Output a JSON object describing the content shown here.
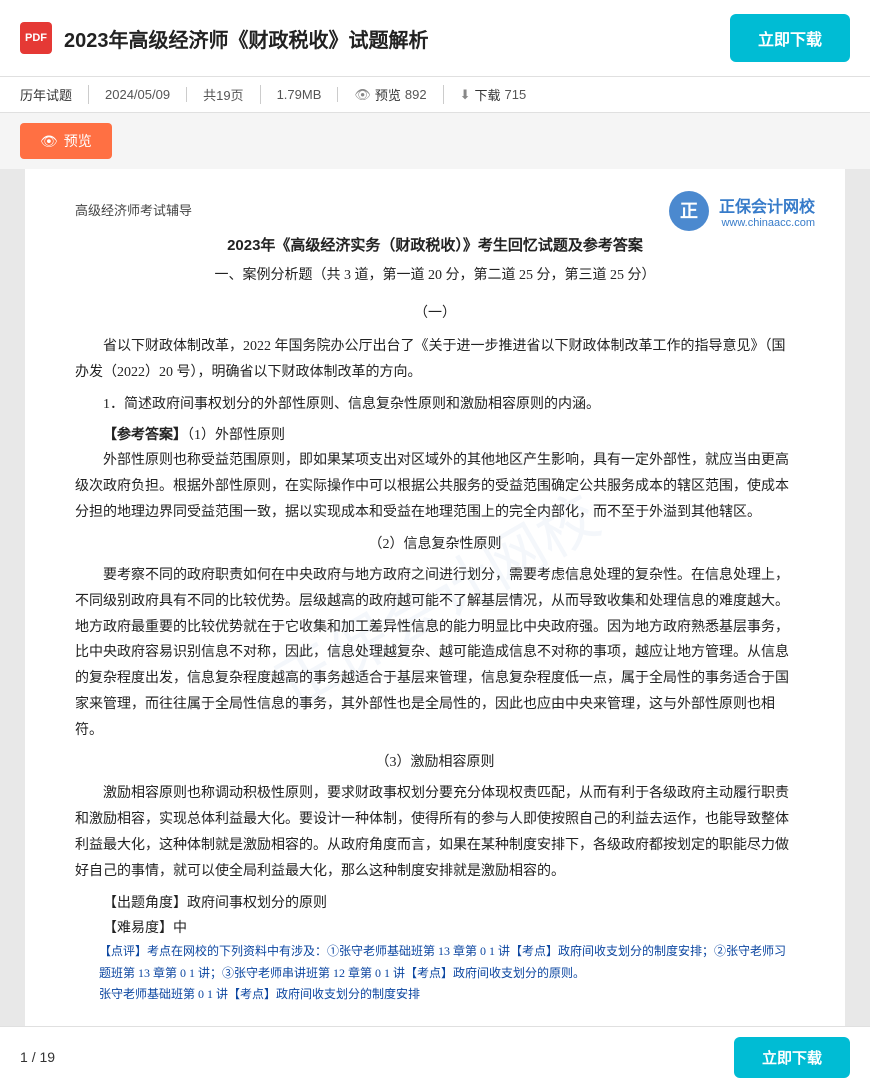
{
  "header": {
    "pdf_label": "PDF",
    "title": "2023年高级经济师《财政税收》试题解析",
    "download_btn": "立即下载"
  },
  "meta": {
    "category": "历年试题",
    "date": "2024/05/09",
    "pages_label": "共19页",
    "size": "1.79MB",
    "preview_label": "预览",
    "preview_count": "892",
    "download_label": "下载",
    "download_count": "715"
  },
  "preview_btn": "预览",
  "doc": {
    "subtitle": "高级经济师考试辅导",
    "main_title": "2023年《高级经济实务（财政税收）》考生回忆试题及参考答案",
    "sub_title": "一、案例分析题（共 3 道，第一道 20 分，第二道 25 分，第三道 25 分）",
    "section1": "（一）",
    "para1": "省以下财政体制改革，2022 年国务院办公厅出台了《关于进一步推进省以下财政体制改革工作的指导意见》（国办发（2022）20 号），明确省以下财政体制改革的方向。",
    "question1": "1．简述政府间事权划分的外部性原则、信息复杂性原则和激励相容原则的内涵。",
    "answer_tag": "【参考答案】",
    "ans1_sub": "（1）外部性原则",
    "ans1_para": "外部性原则也称受益范围原则，即如果某项支出对区域外的其他地区产生影响，具有一定外部性，就应当由更高级次政府负担。根据外部性原则，在实际操作中可以根据公共服务的受益范围确定公共服务成本的辖区范围，使成本分担的地理边界同受益范围一致，据以实现成本和受益在地理范围上的完全内部化，而不至于外溢到其他辖区。",
    "ans2_sub": "（2）信息复杂性原则",
    "ans2_para": "要考察不同的政府职责如何在中央政府与地方政府之间进行划分，需要考虑信息处理的复杂性。在信息处理上，不同级别政府具有不同的比较优势。层级越高的政府越可能不了解基层情况，从而导致收集和处理信息的难度越大。地方政府最重要的比较优势就在于它收集和加工差异性信息的能力明显比中央政府强。因为地方政府熟悉基层事务，比中央政府容易识别信息不对称，因此，信息处理越复杂、越可能造成信息不对称的事项，越应让地方管理。从信息的复杂程度出发，信息复杂程度越高的事务越适合于基层来管理，信息复杂程度低一点，属于全局性的事务适合于国家来管理，而往往属于全局性信息的事务，其外部性也是全局性的，因此也应由中央来管理，这与外部性原则也相符。",
    "ans3_sub": "（3）激励相容原则",
    "ans3_para": "激励相容原则也称调动积极性原则，要求财政事权划分要充分体现权责匹配，从而有利于各级政府主动履行职责和激励相容，实现总体利益最大化。要设计一种体制，使得所有的参与人即使按照自己的利益去运作，也能导致整体利益最大化，这种体制就是激励相容的。从政府角度而言，如果在某种制度安排下，各级政府都按划定的职能尽力做好自己的事情，就可以使全局利益最大化，那么这种制度安排就是激励相容的。",
    "tag1": "【出题角度】政府间事权划分的原则",
    "tag2": "【难易度】中",
    "tag3_prefix": "【点评】考点在网校的下列资料中有涉及：①张守老师基础班第 13 章第 0 1 讲【考点】政府间收支划分的制度安排；②张守老师习题班第 13 章第 0 1 讲；③张守老师串讲班第 12 章第 0 1 讲【考点】政府间收支划分的原则。",
    "tag3_suffix": "张守老师基础班第 0 1 讲【考点】政府间收支划分的制度安排"
  },
  "watermark": {
    "site_name": "正保会计网校",
    "site_url": "www.chinaacc.com"
  },
  "footer": {
    "page_current": "1",
    "page_total": "19",
    "separator": "/",
    "download_btn": "立即下载"
  }
}
